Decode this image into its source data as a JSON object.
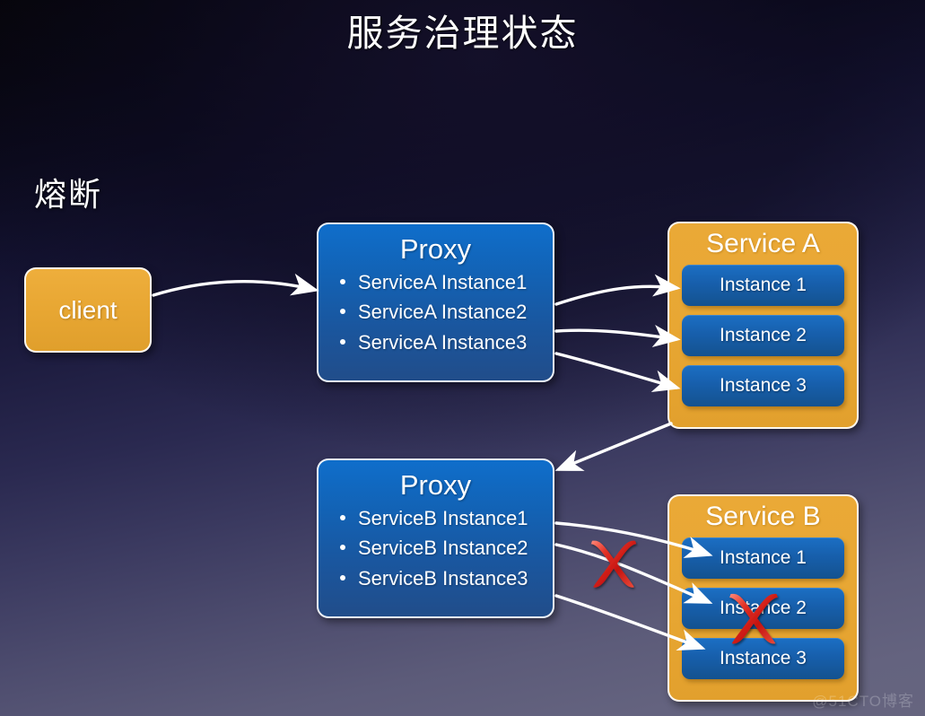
{
  "slide": {
    "title": "服务治理状态",
    "section_label": "熔断",
    "watermark": "@51CTO博客",
    "colors": {
      "background_top": "#050407",
      "background_bottom": "#66657f",
      "orange": "#e8a733",
      "blue": "#1263b6",
      "instance_blue": "#175fac",
      "arrow": "#ffffff",
      "cross_red": "#d81f1f",
      "text": "#ffffff"
    }
  },
  "nodes": {
    "client": {
      "label": "client"
    },
    "proxy_a": {
      "title": "Proxy",
      "items": [
        "ServiceA Instance1",
        "ServiceA Instance2",
        "ServiceA Instance3"
      ]
    },
    "proxy_b": {
      "title": "Proxy",
      "items": [
        "ServiceB Instance1",
        "ServiceB Instance2",
        "ServiceB Instance3"
      ]
    },
    "service_a": {
      "title": "Service A",
      "instances": [
        "Instance 1",
        "Instance 2",
        "Instance 3"
      ]
    },
    "service_b": {
      "title": "Service B",
      "instances": [
        "Instance 1",
        "Instance 2",
        "Instance 3"
      ]
    }
  },
  "edges": [
    {
      "name": "client-to-proxy-a",
      "from": "client",
      "to": "proxy_a"
    },
    {
      "name": "proxy-a-to-instance-1",
      "from": "proxy_a",
      "to": "service_a.instance_1"
    },
    {
      "name": "proxy-a-to-instance-2",
      "from": "proxy_a",
      "to": "service_a.instance_2"
    },
    {
      "name": "proxy-a-to-instance-3",
      "from": "proxy_a",
      "to": "service_a.instance_3"
    },
    {
      "name": "service-a-to-proxy-b",
      "from": "service_a",
      "to": "proxy_b"
    },
    {
      "name": "proxy-b-to-instance-1",
      "from": "proxy_b",
      "to": "service_b.instance_1"
    },
    {
      "name": "proxy-b-to-instance-2",
      "from": "proxy_b",
      "to": "service_b.instance_2"
    },
    {
      "name": "proxy-b-to-instance-3",
      "from": "proxy_b",
      "to": "service_b.instance_3"
    }
  ],
  "markers": [
    {
      "name": "cross-on-edge-to-service-b-instance-2",
      "type": "red-cross",
      "target": "proxy-b-to-instance-2 edge"
    },
    {
      "name": "cross-on-service-b-instance-2",
      "type": "red-cross",
      "target": "service_b.instance_2"
    }
  ]
}
